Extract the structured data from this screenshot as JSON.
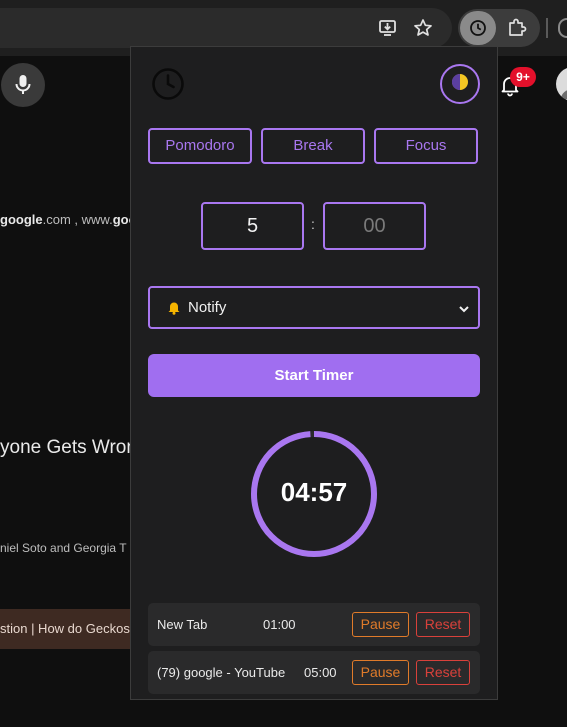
{
  "background_page": {
    "url_snippet_bold": "google",
    "url_snippet_rest": ".com , www.",
    "url_snippet_tail": "goo",
    "headline": "yone Gets Wron",
    "authors": "niel Soto and Georgia T",
    "chip_text": "stion | How do Geckos",
    "badge": "9+"
  },
  "popup": {
    "modes": [
      {
        "label": "Pomodoro"
      },
      {
        "label": "Break"
      },
      {
        "label": "Focus"
      }
    ],
    "minutes_value": "5",
    "seconds_placeholder": "00",
    "separator": ":",
    "notify_selected": "Notify",
    "start_label": "Start Timer",
    "countdown": "04:57",
    "countdown_progress": 0.99,
    "tasks": [
      {
        "title": "New Tab",
        "duration": "01:00",
        "pause": "Pause",
        "reset": "Reset"
      },
      {
        "title": "(79) google - YouTube",
        "duration": "05:00",
        "pause": "Pause",
        "reset": "Reset"
      }
    ]
  },
  "colors": {
    "accent": "#a977f0",
    "start_button": "#a06ef0",
    "pause": "#e07b2a",
    "reset": "#d9413b",
    "badge": "#e3102b"
  },
  "icons": {
    "omnibox_install": "install-app-icon",
    "omnibox_star": "bookmark-star-icon",
    "extension_active": "clock-extension-icon",
    "extensions_menu": "puzzle-icon",
    "mic": "microphone-icon",
    "notifications": "bell-icon",
    "logo": "clock-icon",
    "theme": "half-moon-icon"
  }
}
